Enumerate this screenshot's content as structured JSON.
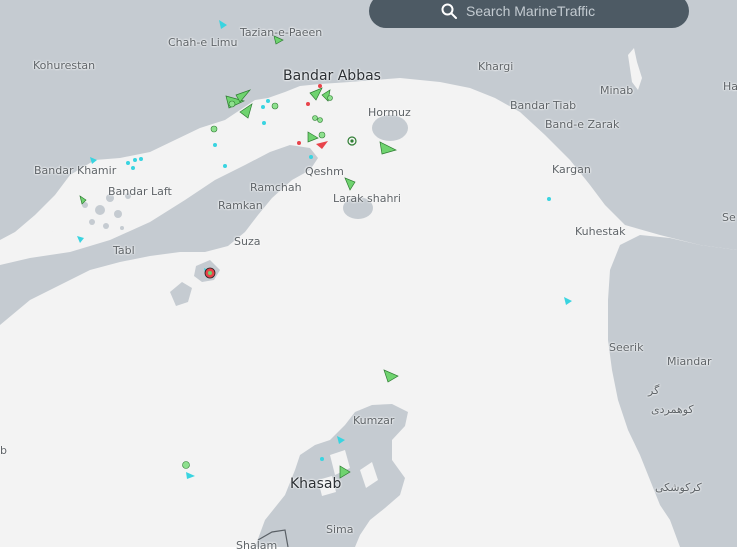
{
  "search": {
    "placeholder": "Search MarineTraffic"
  },
  "colors": {
    "sea": "#f3f3f3",
    "land": "#c5cbd1",
    "cargo_vessel": "#6fd36f",
    "passenger_vessel": "#39d4e0",
    "tanker": "#e8434b",
    "search_bar": "#4d5a64"
  },
  "places": {
    "tazian": "Tazian-e-Paeen",
    "chah_limu": "Chah-e Limu",
    "kohurestan": "Kohurestan",
    "bandar_abbas": "Bandar Abbas",
    "khargi": "Khargi",
    "minab": "Minab",
    "ha": "Ha",
    "bandar_tiab": "Bandar Tiab",
    "band_zarak": "Band-e Zarak",
    "hormuz": "Hormuz",
    "bandar_khamir": "Bandar Khamir",
    "bandar_laft": "Bandar Laft",
    "qeshm": "Qeshm",
    "kargan": "Kargan",
    "ramchah": "Ramchah",
    "larak": "Larak shahri",
    "ramkan": "Ramkan",
    "tabl": "Tabl",
    "suza": "Suza",
    "kuhestak": "Kuhestak",
    "se": "Se",
    "seerik": "Seerik",
    "miandar": "Miandar",
    "gar": "گر",
    "kuhmardi": "کوهمردی",
    "kumzar": "Kumzar",
    "b": "b",
    "khasab": "Khasab",
    "kargoshki": "کرکوشکی",
    "sima": "Sima",
    "shalam": "Shalam"
  }
}
